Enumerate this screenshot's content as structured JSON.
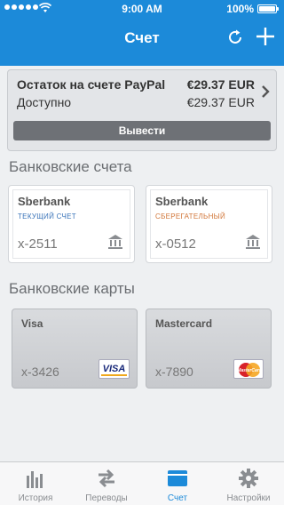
{
  "status_bar": {
    "time": "9:00 AM",
    "battery_percent": "100%",
    "battery_level": 1.0
  },
  "header": {
    "title": "Счет",
    "refresh_icon": "refresh-icon",
    "add_icon": "plus-icon"
  },
  "balance": {
    "title_label": "Остаток на счете PayPal",
    "title_value": "€29.37 EUR",
    "available_label": "Доступно",
    "available_value": "€29.37 EUR",
    "withdraw_label": "Вывести"
  },
  "bank_accounts": {
    "section_title": "Банковские счета",
    "items": [
      {
        "name": "Sberbank",
        "type": "ТЕКУЩИЙ СЧЕТ",
        "type_color": "#3a74b9",
        "number": "x-2511"
      },
      {
        "name": "Sberbank",
        "type": "СБЕРЕГАТЕЛЬНЫЙ",
        "type_color": "#d2773a",
        "number": "x-0512"
      }
    ]
  },
  "bank_cards": {
    "section_title": "Банковские карты",
    "items": [
      {
        "name": "Visa",
        "number": "x-3426",
        "logo_text": "VISA"
      },
      {
        "name": "Mastercard",
        "number": "x-7890",
        "logo_text": "MasterCard"
      }
    ]
  },
  "tabbar": {
    "items": [
      {
        "label": "История",
        "icon": "bar-chart-icon",
        "active": false
      },
      {
        "label": "Переводы",
        "icon": "transfer-arrows-icon",
        "active": false
      },
      {
        "label": "Счет",
        "icon": "wallet-icon",
        "active": true
      },
      {
        "label": "Настройки",
        "icon": "gear-icon",
        "active": false
      }
    ]
  },
  "colors": {
    "brand_blue": "#1c8ad9",
    "header_text": "#ffffff",
    "inactive_tab": "#8a8d91"
  }
}
